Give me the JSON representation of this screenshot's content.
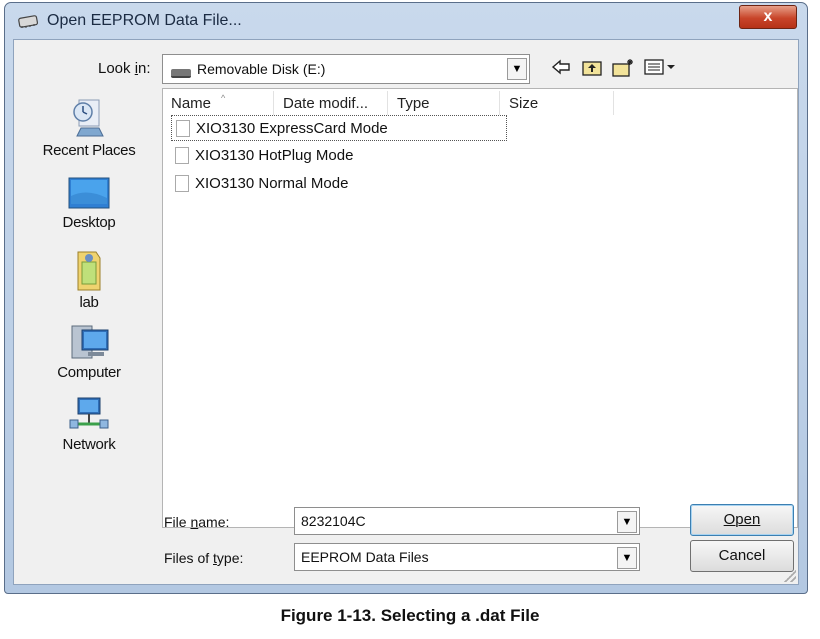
{
  "window": {
    "title": "Open EEPROM Data File...",
    "close_label": "x"
  },
  "toolbar": {
    "look_in_label": "Look in:",
    "look_in_value": "Removable Disk (E:)",
    "icons": [
      "back-arrow-icon",
      "up-folder-icon",
      "new-folder-icon",
      "views-menu-icon"
    ]
  },
  "places": [
    {
      "label": "Recent Places",
      "icon": "recent-places-icon"
    },
    {
      "label": "Desktop",
      "icon": "desktop-icon"
    },
    {
      "label": "lab",
      "icon": "user-folder-icon"
    },
    {
      "label": "Computer",
      "icon": "computer-icon"
    },
    {
      "label": "Network",
      "icon": "network-icon"
    }
  ],
  "columns": [
    "Name",
    "Date modif...",
    "Type",
    "Size"
  ],
  "files": [
    {
      "name": "XIO3130 ExpressCard Mode"
    },
    {
      "name": "XIO3130 HotPlug Mode"
    },
    {
      "name": "XIO3130 Normal Mode"
    }
  ],
  "filename": {
    "label": "File name:",
    "value": "8232104C"
  },
  "filetype": {
    "label": "Files of type:",
    "value": "EEPROM Data Files"
  },
  "buttons": {
    "open": "Open",
    "cancel": "Cancel"
  },
  "caption": "Figure 1-13. Selecting a .dat File",
  "colors": {
    "frame": "#b3c8e2",
    "close": "#c8452a",
    "client": "#f0f0f0"
  }
}
